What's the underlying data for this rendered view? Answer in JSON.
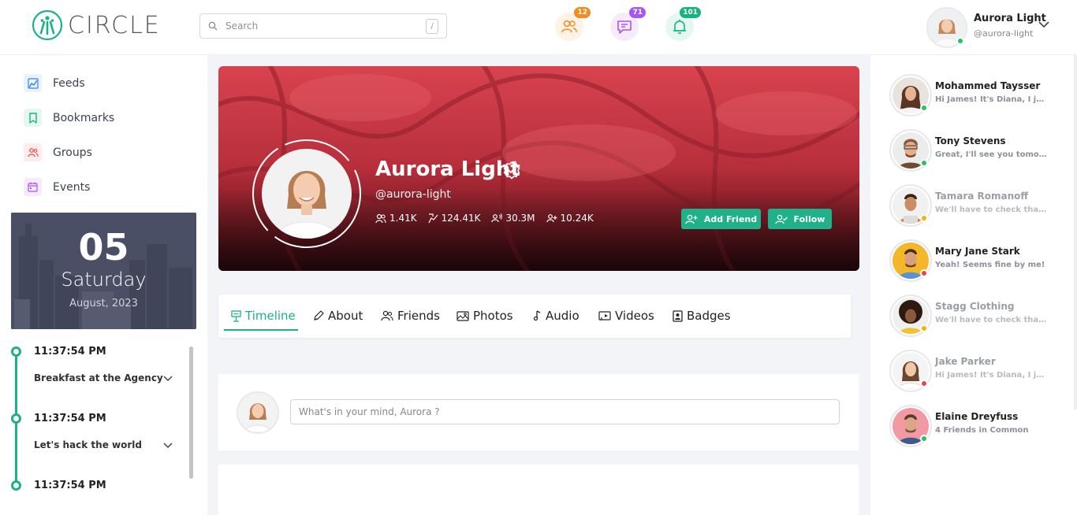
{
  "brand": {
    "logo_text": "CIRCLE"
  },
  "header": {
    "search_placeholder": "Search",
    "search_shortcut": "/",
    "badges": {
      "friends": "12",
      "messages": "71",
      "notifications": "101"
    },
    "user": {
      "name": "Aurora Light",
      "handle": "@aurora-light"
    }
  },
  "sidebar": {
    "nav": [
      {
        "label": "Feeds",
        "icon": "feeds-icon"
      },
      {
        "label": "Bookmarks",
        "icon": "bookmark-icon"
      },
      {
        "label": "Groups",
        "icon": "groups-icon"
      },
      {
        "label": "Events",
        "icon": "calendar-icon"
      }
    ],
    "date": {
      "day": "05",
      "weekday": "Saturday",
      "month_year": "August, 2023"
    },
    "timeline": [
      {
        "time": "11:37:54 PM",
        "title": "Breakfast at the Agency"
      },
      {
        "time": "11:37:54 PM",
        "title": "Let's hack the world"
      },
      {
        "time": "11:37:54 PM",
        "title": ""
      }
    ]
  },
  "profile": {
    "name": "Aurora Light",
    "handle": "@aurora-light",
    "stats": {
      "followers": "1.41K",
      "posts": "124.41K",
      "views": "30.3M",
      "following": "10.24K"
    },
    "add_friend_label": "Add Friend",
    "follow_label": "Follow"
  },
  "tabs": [
    {
      "label": "Timeline",
      "icon": "timeline-icon",
      "active": true
    },
    {
      "label": "About",
      "icon": "pen-icon"
    },
    {
      "label": "Friends",
      "icon": "friends-icon"
    },
    {
      "label": "Photos",
      "icon": "photos-icon"
    },
    {
      "label": "Audio",
      "icon": "music-note-icon"
    },
    {
      "label": "Videos",
      "icon": "video-icon"
    },
    {
      "label": "Badges",
      "icon": "badge-icon"
    }
  ],
  "composer": {
    "placeholder": "What's in your mind, Aurora ?"
  },
  "contacts": [
    {
      "name": "Mohammed Taysser",
      "message": "Hi James! It's Diana, I just sent you the file",
      "status": "online"
    },
    {
      "name": "Tony Stevens",
      "message": "Great, I'll see you tomorrow!.",
      "status": "online"
    },
    {
      "name": "Tamara Romanoff",
      "message": "We'll have to check that at the office",
      "status": "away"
    },
    {
      "name": "Mary Jane Stark",
      "message": "Yeah! Seems fine by me!",
      "status": "busy"
    },
    {
      "name": "Stagg Clothing",
      "message": "We'll have to check that at the office",
      "status": "away"
    },
    {
      "name": "Jake Parker",
      "message": "Hi James! It's Diana, I just sent you the file",
      "status": "busy"
    },
    {
      "name": "Elaine Dreyfuss",
      "message": "4 Friends in Common",
      "status": "online"
    }
  ],
  "colors": {
    "accent": "#1db08a",
    "friends_badge": "#f58a1f",
    "messages_badge": "#a855f7",
    "notifications_badge": "#16b27f",
    "online": "#22c55e",
    "away": "#f5b400",
    "busy": "#ef4444"
  }
}
